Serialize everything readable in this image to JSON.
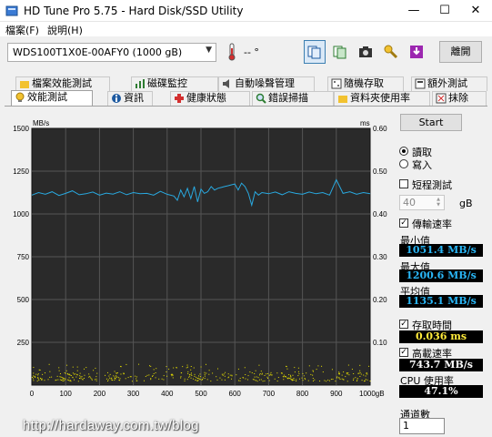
{
  "window": {
    "title": "HD Tune Pro 5.75 - Hard Disk/SSD Utility"
  },
  "menu": {
    "file": "檔案(F)",
    "help": "說明(H)"
  },
  "toolbar": {
    "drive": "WDS100T1X0E-00AFY0 (1000 gB)",
    "temperature": "-- °",
    "exit_label": "離開",
    "icons": [
      "thermometer-icon",
      "copy-info-icon",
      "copy-text-icon",
      "camera-icon",
      "key-icon",
      "save-icon"
    ]
  },
  "tabs": {
    "row1": [
      "檔案效能測試",
      "磁碟監控",
      "自動噪聲管理",
      "隨機存取",
      "額外測試"
    ],
    "row2": [
      "效能測試",
      "資訊",
      "健康狀態",
      "錯誤掃描",
      "資料夾使用率",
      "抹除"
    ]
  },
  "side": {
    "start_label": "Start",
    "read_label": "讀取",
    "write_label": "寫入",
    "short_test_label": "短程測試",
    "size_value": "40",
    "size_unit": "gB",
    "transfer_rate_label": "傳輸速率",
    "min_label": "最小值",
    "min_value": "1051.4 MB/s",
    "max_label": "最大值",
    "max_value": "1200.6 MB/s",
    "avg_label": "平均值",
    "avg_value": "1135.1 MB/s",
    "access_time_label": "存取時間",
    "access_time_value": "0.036 ms",
    "burst_rate_label": "高載速率",
    "burst_rate_value": "743.7 MB/s",
    "cpu_label": "CPU 使用率",
    "cpu_value": "47.1%",
    "channels_label": "通道數",
    "channels_value": "1"
  },
  "colors": {
    "plot_bg": "#2a2a2a",
    "transfer_line": "#29a9e0",
    "access_dots": "#e8e000",
    "grid": "#555555"
  },
  "watermark": "http://hardaway.com.tw/blog",
  "chart_data": {
    "type": "line",
    "y_left_label": "MB/s",
    "y_right_label": "ms",
    "x_unit": "gB",
    "x_ticks": [
      "0",
      "100",
      "200",
      "300",
      "400",
      "500",
      "600",
      "700",
      "800",
      "900",
      "1000gB"
    ],
    "y_left_ticks": [
      "1500",
      "1250",
      "1000",
      "750",
      "500",
      "250"
    ],
    "y_right_ticks": [
      "0.60",
      "0.50",
      "0.40",
      "0.30",
      "0.20",
      "0.10"
    ],
    "xlim": [
      0,
      1000
    ],
    "ylim_left": [
      0,
      1500
    ],
    "ylim_right": [
      0,
      0.6
    ],
    "grid": true,
    "series": [
      {
        "units": "MB/s",
        "x": [
          0,
          20,
          40,
          60,
          80,
          100,
          120,
          140,
          160,
          180,
          200,
          220,
          240,
          260,
          280,
          300,
          320,
          340,
          360,
          380,
          400,
          420,
          430,
          440,
          450,
          460,
          470,
          480,
          490,
          500,
          510,
          520,
          530,
          540,
          550,
          560,
          570,
          580,
          590,
          600,
          610,
          620,
          630,
          640,
          650,
          660,
          670,
          680,
          700,
          720,
          740,
          760,
          780,
          800,
          820,
          840,
          860,
          880,
          900,
          920,
          940,
          960,
          980,
          1000
        ],
        "y": [
          1110,
          1125,
          1115,
          1130,
          1108,
          1120,
          1135,
          1112,
          1118,
          1128,
          1110,
          1122,
          1116,
          1130,
          1112,
          1125,
          1118,
          1120,
          1110,
          1132,
          1115,
          1105,
          1080,
          1140,
          1100,
          1150,
          1090,
          1160,
          1070,
          1145,
          1120,
          1130,
          1160,
          1140,
          1150,
          1155,
          1160,
          1165,
          1170,
          1175,
          1140,
          1180,
          1160,
          1120,
          1051,
          1130,
          1110,
          1125,
          1118,
          1128,
          1112,
          1130,
          1120,
          1115,
          1128,
          1118,
          1125,
          1110,
          1200,
          1120,
          1130,
          1115,
          1125,
          1118
        ]
      },
      {
        "units": "ms",
        "type": "scatter",
        "band": [
          0.01,
          0.05
        ],
        "typical": 0.036
      }
    ]
  }
}
